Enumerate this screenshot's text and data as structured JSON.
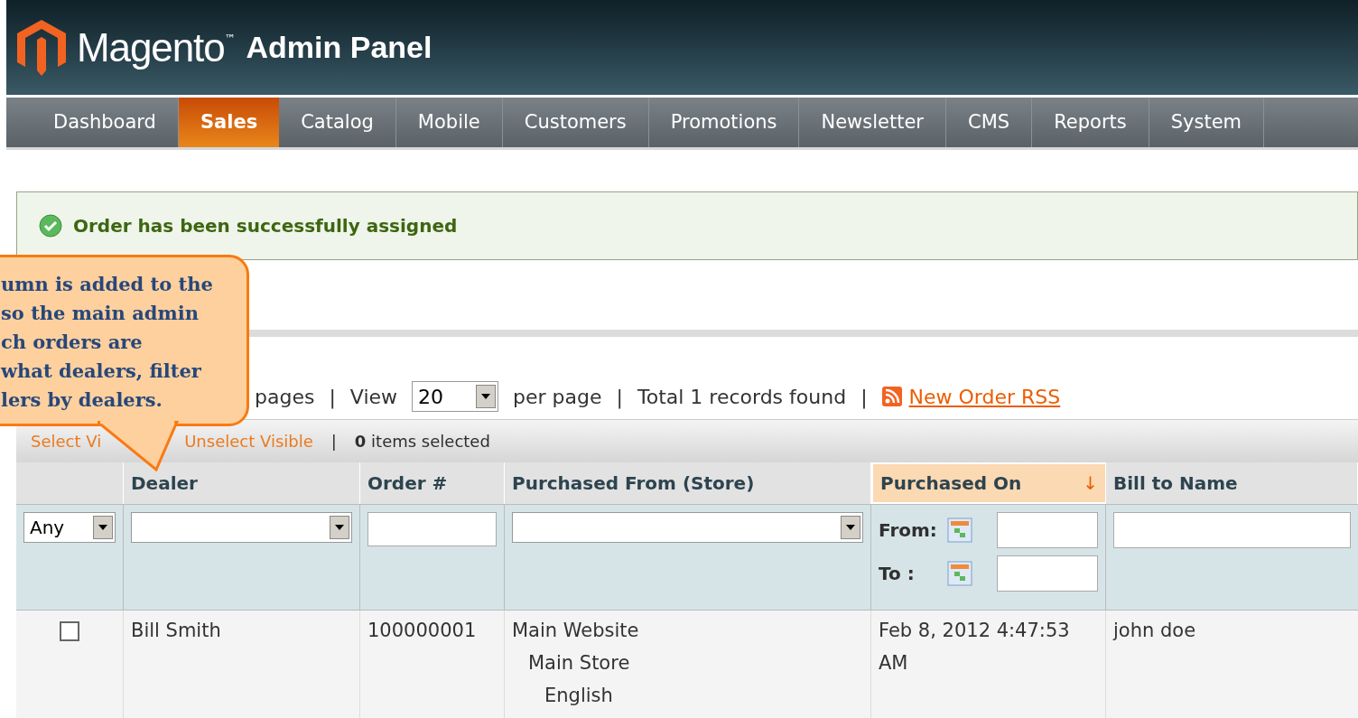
{
  "header": {
    "logo_text": "Magento",
    "trademark": "™",
    "title": "Admin Panel"
  },
  "nav": [
    {
      "label": "Dashboard",
      "selected": false
    },
    {
      "label": "Sales",
      "selected": true
    },
    {
      "label": "Catalog",
      "selected": false
    },
    {
      "label": "Mobile",
      "selected": false
    },
    {
      "label": "Customers",
      "selected": false
    },
    {
      "label": "Promotions",
      "selected": false
    },
    {
      "label": "Newsletter",
      "selected": false
    },
    {
      "label": "CMS",
      "selected": false
    },
    {
      "label": "Reports",
      "selected": false
    },
    {
      "label": "System",
      "selected": false
    }
  ],
  "message": "Order has been successfully assigned",
  "callout": {
    "lines": [
      "umn is added to the",
      "so the main admin",
      "ch orders are",
      "what dealers, filter",
      "lers by dealers."
    ]
  },
  "pager": {
    "pages": "pages",
    "sep1": "|",
    "view": "View",
    "per_page_value": "20",
    "per_page": "per page",
    "sep2": "|",
    "total": "Total 1 records found",
    "sep3": "|",
    "rss_link": "New Order RSS"
  },
  "massaction": {
    "select_visible": "Select Vi",
    "unselect_visible": "Unselect Visible",
    "sep": "|",
    "selected_count": "**0** items selected"
  },
  "table": {
    "columns": [
      {
        "sorted": false
      },
      {
        "label": "Dealer",
        "sorted": false
      },
      {
        "label": "Order #",
        "sorted": false
      },
      {
        "label": "Purchased From (Store)",
        "sorted": false
      },
      {
        "label": "Purchased On",
        "sorted": true,
        "sort_arrow": "↓"
      },
      {
        "label": "Bill to Name",
        "sorted": false
      }
    ],
    "filters": {
      "massaction_value": "Any",
      "from_label": "From:",
      "to_label": "To :"
    },
    "rows": [
      {
        "checked": false,
        "dealer": "Bill Smith",
        "order": "100000001",
        "store": [
          "Main Website",
          "Main Store",
          "English"
        ],
        "purchased_on": "Feb 8, 2012 4:47:53 AM",
        "bill_to": "john doe"
      }
    ]
  }
}
